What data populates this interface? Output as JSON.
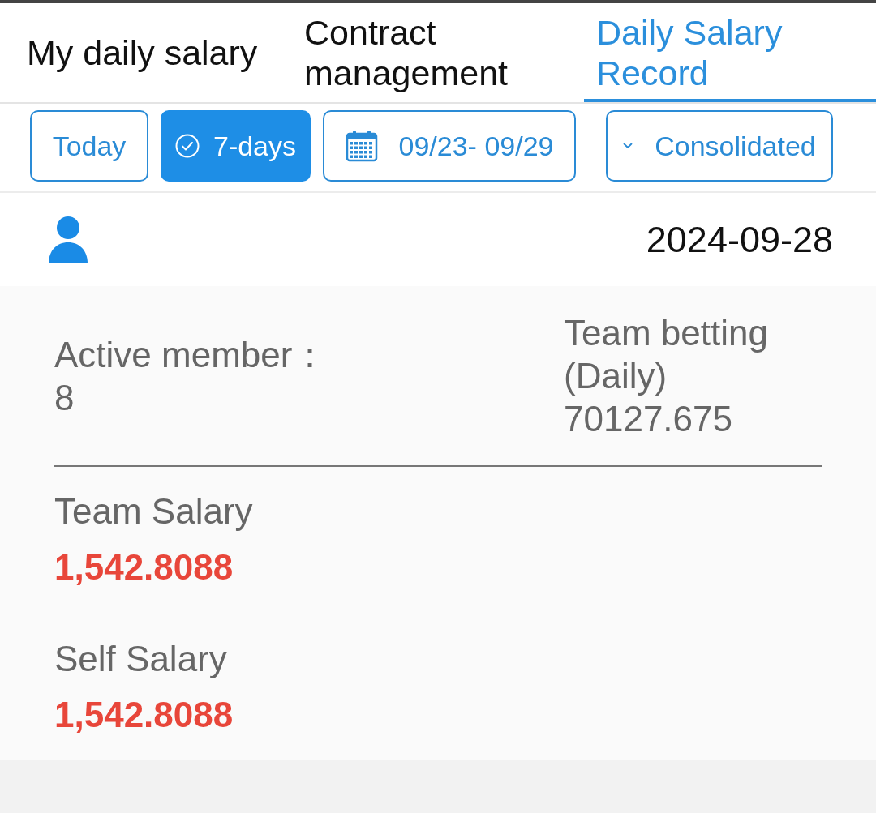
{
  "tabs": [
    {
      "label": "My daily salary",
      "selected": false
    },
    {
      "label": "Contract management",
      "selected": false
    },
    {
      "label": "Daily Salary Record",
      "selected": true
    }
  ],
  "filters": [
    {
      "kind": "preset",
      "label": "Today",
      "selected": false
    },
    {
      "kind": "preset",
      "label": "7-days",
      "selected": true
    },
    {
      "kind": "date-range",
      "label": "09/23- 09/29",
      "selected": false
    },
    {
      "kind": "dropdown",
      "label": "Consolidated",
      "selected": false
    }
  ],
  "record": {
    "date": "2024-09-28",
    "stats": [
      {
        "label": "Active member：",
        "value": "8"
      },
      {
        "label": "Team betting (Daily)",
        "value": "70127.675"
      }
    ],
    "salaries": [
      {
        "label": "Team Salary",
        "value": "1,542.8088"
      },
      {
        "label": "Self Salary",
        "value": "1,542.8088"
      }
    ]
  }
}
